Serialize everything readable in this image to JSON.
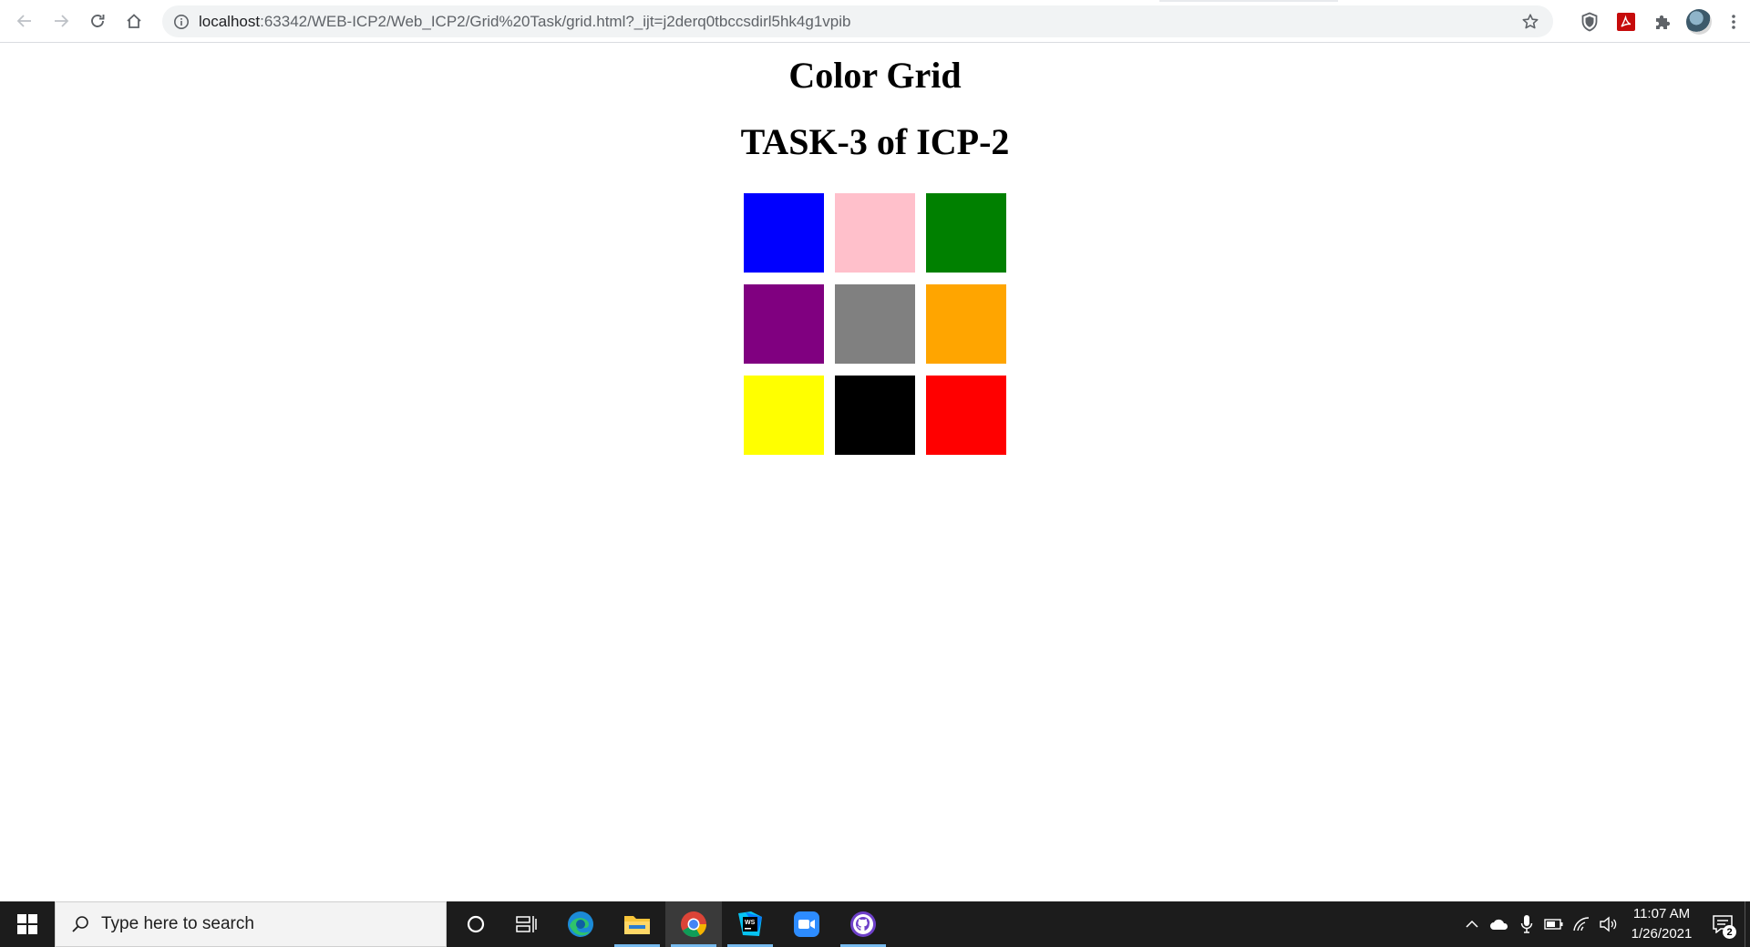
{
  "browser": {
    "url_host": "localhost",
    "url_path": ":63342/WEB-ICP2/Web_ICP2/Grid%20Task/grid.html?_ijt=j2derq0tbccsdirl5hk4g1vpib",
    "icons": [
      "back-icon",
      "forward-icon",
      "reload-icon",
      "home-icon",
      "info-icon",
      "star-icon",
      "shield-extension-icon",
      "pdf-extension-icon",
      "puzzle-extensions-icon",
      "profile-avatar",
      "kebab-menu-icon"
    ]
  },
  "page": {
    "title": "Color Grid",
    "subtitle": "TASK-3 of ICP-2",
    "grid_colors": [
      "#0000ff",
      "#ffc0cb",
      "#008000",
      "#800080",
      "#808080",
      "#ffa500",
      "#ffff00",
      "#000000",
      "#ff0000"
    ]
  },
  "taskbar": {
    "search_placeholder": "Type here to search",
    "apps": [
      "cortana-icon",
      "task-view-icon",
      "edge-icon",
      "file-explorer-icon",
      "chrome-icon",
      "webstorm-icon",
      "zoom-icon",
      "github-desktop-icon"
    ],
    "time": "11:07 AM",
    "date": "1/26/2021",
    "notification_count": "2"
  },
  "colors": {
    "taskbar_bg": "#1c1c1c",
    "omnibox_bg": "#f1f3f4",
    "active_underline": "#76b9ed"
  }
}
